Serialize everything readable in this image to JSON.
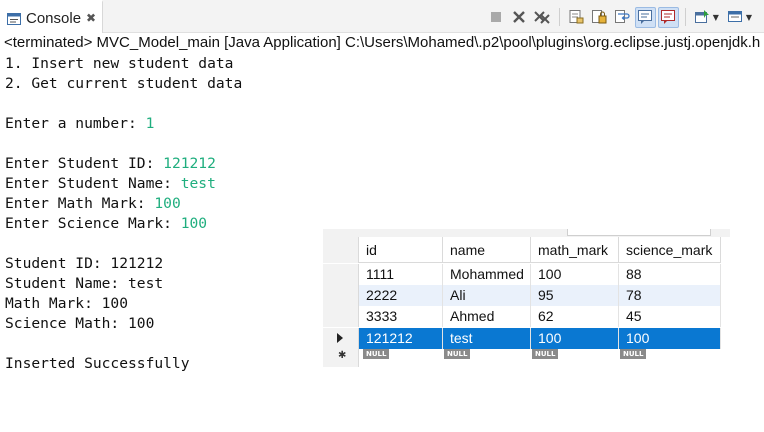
{
  "view": {
    "tab_label": "Console",
    "close_glyph": "✖"
  },
  "toolbar": {
    "buttons": [
      "terminate-icon",
      "remove-launch-icon",
      "remove-all-terminated-icon",
      "clear-console-icon",
      "scroll-lock-icon",
      "word-wrap-icon",
      "show-console-on-stdout-icon",
      "show-console-on-stderr-icon",
      "pin-console-icon",
      "display-selected-console-icon"
    ]
  },
  "status": "<terminated> MVC_Model_main [Java Application] C:\\Users\\Mohamed\\.p2\\pool\\plugins\\org.eclipse.justj.openjdk.h",
  "console": {
    "menu_1": "1. Insert new student data",
    "menu_2": "2. Get current student data",
    "prompt_number": "Enter a number: ",
    "input_number": "1",
    "prompt_id": "Enter Student ID: ",
    "input_id": "121212",
    "prompt_name": "Enter Student Name: ",
    "input_name": "test",
    "prompt_math": "Enter Math Mark: ",
    "input_math": "100",
    "prompt_science": "Enter Science Mark: ",
    "input_science": "100",
    "out_id": "Student ID: 121212",
    "out_name": "Student Name: test",
    "out_math": "Math Mark: 100",
    "out_science": "Science Math: 100",
    "out_result": "Inserted Successfully"
  },
  "grid": {
    "columns": [
      "id",
      "name",
      "math_mark",
      "science_mark"
    ],
    "rows": [
      [
        "1111",
        "Mohammed",
        "100",
        "88"
      ],
      [
        "2222",
        "Ali",
        "95",
        "78"
      ],
      [
        "3333",
        "Ahmed",
        "62",
        "45"
      ],
      [
        "121212",
        "test",
        "100",
        "100"
      ]
    ],
    "null_label": "NULL"
  },
  "colors": {
    "input_text": "#1fae7e",
    "selected_row": "#0a78d2",
    "alt_row": "#eaf1fb"
  }
}
